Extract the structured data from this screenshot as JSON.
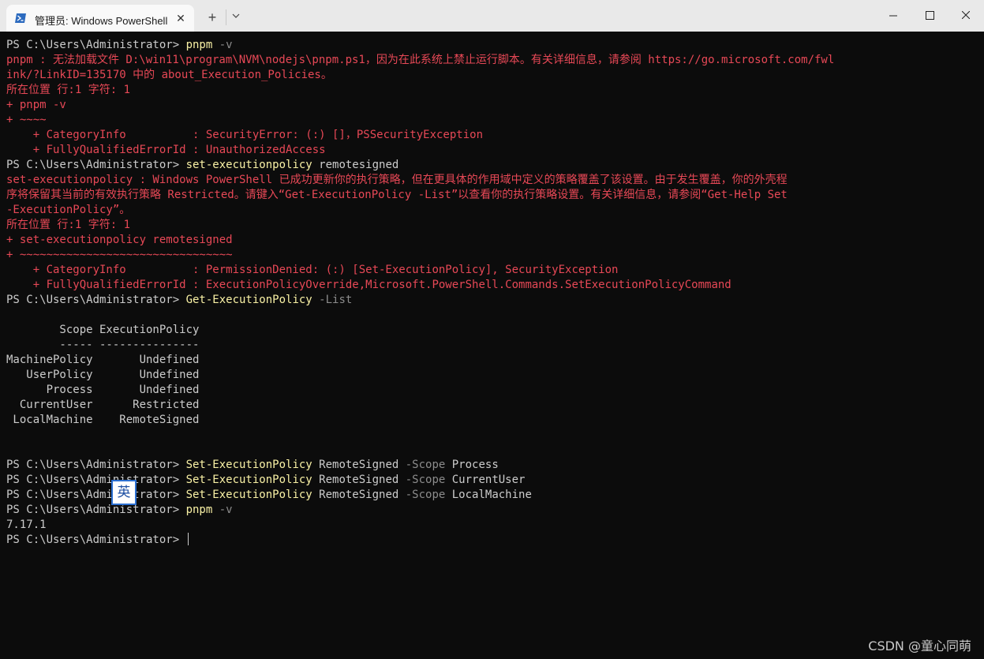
{
  "window": {
    "tab_title": "管理员: Windows PowerShell",
    "tab_icon": "powershell-icon",
    "new_tab_icon": "plus-icon",
    "dropdown_icon": "chevron-down-icon",
    "controls": [
      "minimize-icon",
      "maximize-icon",
      "close-icon"
    ]
  },
  "colors": {
    "background": "#0c0c0c",
    "text": "#cccccc",
    "command": "#f9f1a5",
    "parameter": "#8c8c8c",
    "error": "#e74856"
  },
  "console": {
    "lines": [
      {
        "segments": [
          {
            "c": "white",
            "t": "PS C:\\Users\\Administrator> "
          },
          {
            "c": "yellow",
            "t": "pnpm"
          },
          {
            "c": "gray",
            "t": " -v"
          }
        ]
      },
      {
        "segments": [
          {
            "c": "red",
            "t": "pnpm : 无法加载文件 D:\\win11\\program\\NVM\\nodejs\\pnpm.ps1，因为在此系统上禁止运行脚本。有关详细信息，请参阅 https://go.microsoft.com/fwl"
          }
        ]
      },
      {
        "segments": [
          {
            "c": "red",
            "t": "ink/?LinkID=135170 中的 about_Execution_Policies。"
          }
        ]
      },
      {
        "segments": [
          {
            "c": "red",
            "t": "所在位置 行:1 字符: 1"
          }
        ]
      },
      {
        "segments": [
          {
            "c": "red",
            "t": "+ pnpm -v"
          }
        ]
      },
      {
        "segments": [
          {
            "c": "red",
            "t": "+ ~~~~"
          }
        ]
      },
      {
        "segments": [
          {
            "c": "red",
            "t": "    + CategoryInfo          : SecurityError: (:) []，PSSecurityException"
          }
        ]
      },
      {
        "segments": [
          {
            "c": "red",
            "t": "    + FullyQualifiedErrorId : UnauthorizedAccess"
          }
        ]
      },
      {
        "segments": [
          {
            "c": "white",
            "t": "PS C:\\Users\\Administrator> "
          },
          {
            "c": "yellow",
            "t": "set-executionpolicy"
          },
          {
            "c": "white",
            "t": " remotesigned"
          }
        ]
      },
      {
        "segments": [
          {
            "c": "red",
            "t": "set-executionpolicy : Windows PowerShell 已成功更新你的执行策略，但在更具体的作用域中定义的策略覆盖了该设置。由于发生覆盖，你的外壳程"
          }
        ]
      },
      {
        "segments": [
          {
            "c": "red",
            "t": "序将保留其当前的有效执行策略 Restricted。请键入“Get-ExecutionPolicy -List”以查看你的执行策略设置。有关详细信息，请参阅“Get-Help Set"
          }
        ]
      },
      {
        "segments": [
          {
            "c": "red",
            "t": "-ExecutionPolicy”。"
          }
        ]
      },
      {
        "segments": [
          {
            "c": "red",
            "t": "所在位置 行:1 字符: 1"
          }
        ]
      },
      {
        "segments": [
          {
            "c": "red",
            "t": "+ set-executionpolicy remotesigned"
          }
        ]
      },
      {
        "segments": [
          {
            "c": "red",
            "t": "+ ~~~~~~~~~~~~~~~~~~~~~~~~~~~~~~~~"
          }
        ]
      },
      {
        "segments": [
          {
            "c": "red",
            "t": "    + CategoryInfo          : PermissionDenied: (:) [Set-ExecutionPolicy], SecurityException"
          }
        ]
      },
      {
        "segments": [
          {
            "c": "red",
            "t": "    + FullyQualifiedErrorId : ExecutionPolicyOverride,Microsoft.PowerShell.Commands.SetExecutionPolicyCommand"
          }
        ]
      },
      {
        "segments": [
          {
            "c": "white",
            "t": "PS C:\\Users\\Administrator> "
          },
          {
            "c": "yellow",
            "t": "Get-ExecutionPolicy"
          },
          {
            "c": "gray",
            "t": " -List"
          }
        ]
      },
      {
        "segments": [
          {
            "c": "white",
            "t": ""
          }
        ]
      },
      {
        "segments": [
          {
            "c": "white",
            "t": "        Scope ExecutionPolicy"
          }
        ]
      },
      {
        "segments": [
          {
            "c": "white",
            "t": "        ----- ---------------"
          }
        ]
      },
      {
        "segments": [
          {
            "c": "white",
            "t": "MachinePolicy       Undefined"
          }
        ]
      },
      {
        "segments": [
          {
            "c": "white",
            "t": "   UserPolicy       Undefined"
          }
        ]
      },
      {
        "segments": [
          {
            "c": "white",
            "t": "      Process       Undefined"
          }
        ]
      },
      {
        "segments": [
          {
            "c": "white",
            "t": "  CurrentUser      Restricted"
          }
        ]
      },
      {
        "segments": [
          {
            "c": "white",
            "t": " LocalMachine    RemoteSigned"
          }
        ]
      },
      {
        "segments": [
          {
            "c": "white",
            "t": ""
          }
        ]
      },
      {
        "segments": [
          {
            "c": "white",
            "t": ""
          }
        ]
      },
      {
        "segments": [
          {
            "c": "white",
            "t": "PS C:\\Users\\Administrator> "
          },
          {
            "c": "yellow",
            "t": "Set-ExecutionPolicy"
          },
          {
            "c": "white",
            "t": " RemoteSigned "
          },
          {
            "c": "gray",
            "t": "-Scope"
          },
          {
            "c": "white",
            "t": " Process"
          }
        ]
      },
      {
        "segments": [
          {
            "c": "white",
            "t": "PS C:\\Users\\Administrator> "
          },
          {
            "c": "yellow",
            "t": "Set-ExecutionPolicy"
          },
          {
            "c": "white",
            "t": " RemoteSigned "
          },
          {
            "c": "gray",
            "t": "-Scope"
          },
          {
            "c": "white",
            "t": " CurrentUser"
          }
        ]
      },
      {
        "segments": [
          {
            "c": "white",
            "t": "PS C:\\Users\\Administrator> "
          },
          {
            "c": "yellow",
            "t": "Set-ExecutionPolicy"
          },
          {
            "c": "white",
            "t": " RemoteSigned "
          },
          {
            "c": "gray",
            "t": "-Scope"
          },
          {
            "c": "white",
            "t": " LocalMachine"
          }
        ]
      },
      {
        "segments": [
          {
            "c": "white",
            "t": "PS C:\\Users\\Administrator> "
          },
          {
            "c": "yellow",
            "t": "pnpm"
          },
          {
            "c": "gray",
            "t": " -v"
          }
        ]
      },
      {
        "segments": [
          {
            "c": "white",
            "t": "7.17.1"
          }
        ]
      },
      {
        "segments": [
          {
            "c": "white",
            "t": "PS C:\\Users\\Administrator> "
          }
        ],
        "cursor": true
      }
    ]
  },
  "ime_indicator": "英",
  "watermark": "CSDN @童心同萌"
}
